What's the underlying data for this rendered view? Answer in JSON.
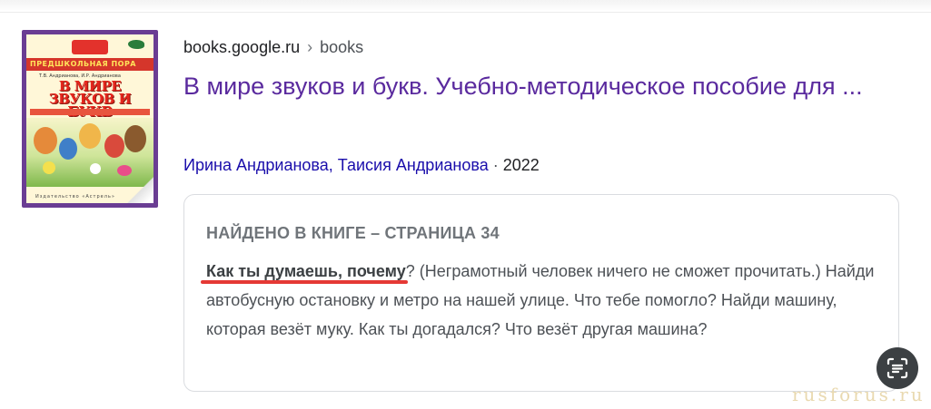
{
  "result": {
    "site_domain": "books.google.ru",
    "site_separator": "›",
    "site_path": "books",
    "title": "В мире звуков и букв. Учебно-методическое пособие для ...",
    "authors": "Ирина Андрианова, Таисия Андрианова",
    "meta_separator": " · ",
    "year": "2022"
  },
  "cover": {
    "series_label": "ПРЕДШКОЛЬНАЯ ПОРА",
    "authors_small": "Т.В. Андрианова, И.Р. Андрианова",
    "title_line1": "В МИРЕ",
    "title_line2": "ЗВУКОВ И БУКВ",
    "publisher": "Издательство «Астрель»"
  },
  "found": {
    "heading": "НАЙДЕНО В КНИГЕ – СТРАНИЦА 34",
    "snippet_bold": "Как ты думаешь, почему",
    "snippet_rest": "? (Неграмотный человек ничего не сможет прочитать.) Найди автобусную остановку и метро на нашей улице. Что тебе помогло? Найди машину, которая везёт муку. Как ты догадался? Что везёт другая машина?"
  },
  "watermark": "rusforus.ru",
  "icons": {
    "lens": "lens-text-icon"
  },
  "colors": {
    "title_link": "#5a2a9e",
    "author_link": "#1a0dab",
    "highlight_underline": "#e53935",
    "lens_button": "#3c4043"
  }
}
